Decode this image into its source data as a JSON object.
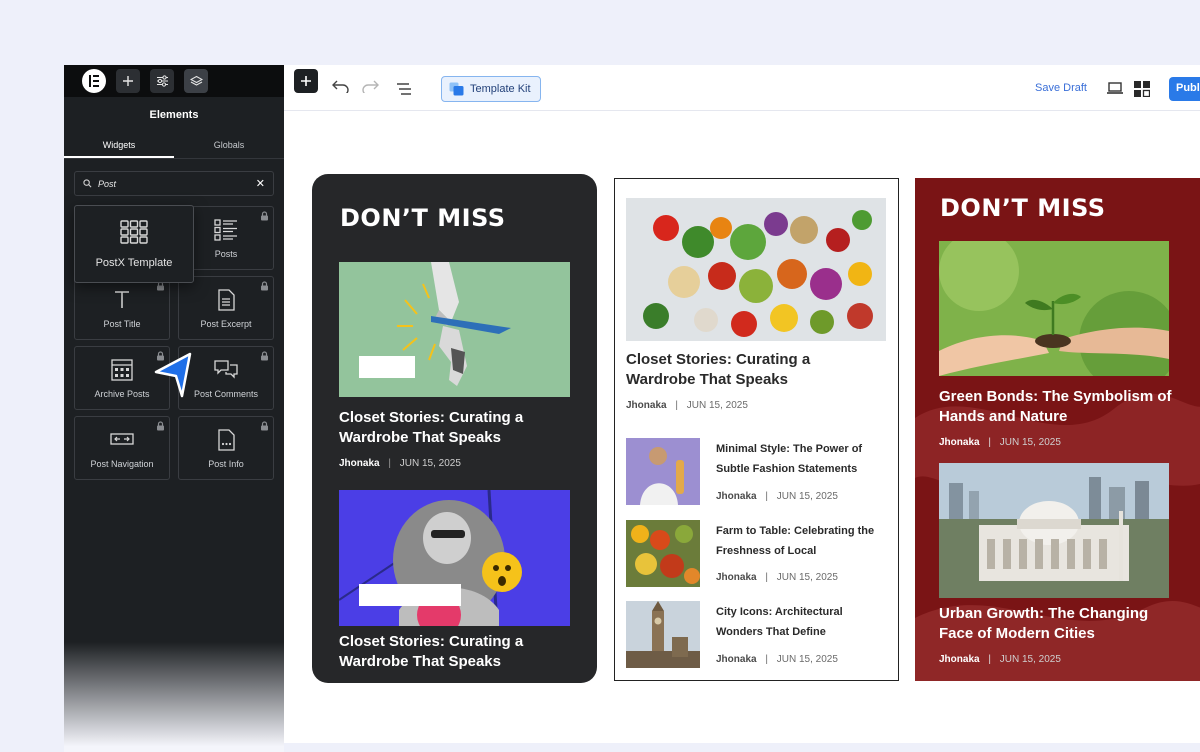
{
  "panel": {
    "title": "Elements",
    "tabs": [
      "Widgets",
      "Globals"
    ],
    "search_value": "Post",
    "popup_widget": "PostX Template",
    "widgets": [
      "Posts",
      "Post Title",
      "Post Excerpt",
      "Archive Posts",
      "Post Comments",
      "Post Navigation",
      "Post Info"
    ]
  },
  "toolbar": {
    "template_kit": "Template Kit",
    "save_draft": "Save Draft",
    "publish": "Publish"
  },
  "cards": {
    "dark": {
      "heading": "DON’T MISS",
      "posts": [
        {
          "title": "Closet Stories: Curating a Wardrobe That Speaks",
          "author": "Jhonaka",
          "date": "JUN 15, 2025"
        },
        {
          "title": "Closet Stories: Curating a Wardrobe That Speaks"
        }
      ]
    },
    "white": {
      "main": {
        "title": "Closet Stories: Curating a Wardrobe That Speaks",
        "author": "Jhonaka",
        "date": "JUN 15, 2025"
      },
      "list": [
        {
          "title": "Minimal Style: The Power of Subtle Fashion Statements",
          "author": "Jhonaka",
          "date": "JUN 15, 2025"
        },
        {
          "title": "Farm to Table: Celebrating the Freshness of Local",
          "author": "Jhonaka",
          "date": "JUN 15, 2025"
        },
        {
          "title": "City Icons: Architectural Wonders That Define",
          "author": "Jhonaka",
          "date": "JUN 15, 2025"
        }
      ]
    },
    "red": {
      "heading": "DON’T MISS",
      "posts": [
        {
          "title": "Green Bonds: The Symbolism of Hands and Nature",
          "author": "Jhonaka",
          "date": "JUN 15, 2025"
        },
        {
          "title": "Urban Growth: The Changing Face of Modern Cities",
          "author": "Jhonaka",
          "date": "JUN 15, 2025"
        }
      ]
    }
  },
  "colors": {
    "accent": "#2a7ae8",
    "panel_bg": "#1d2023",
    "dark_card": "#262729",
    "red_card": "#7a1415"
  }
}
